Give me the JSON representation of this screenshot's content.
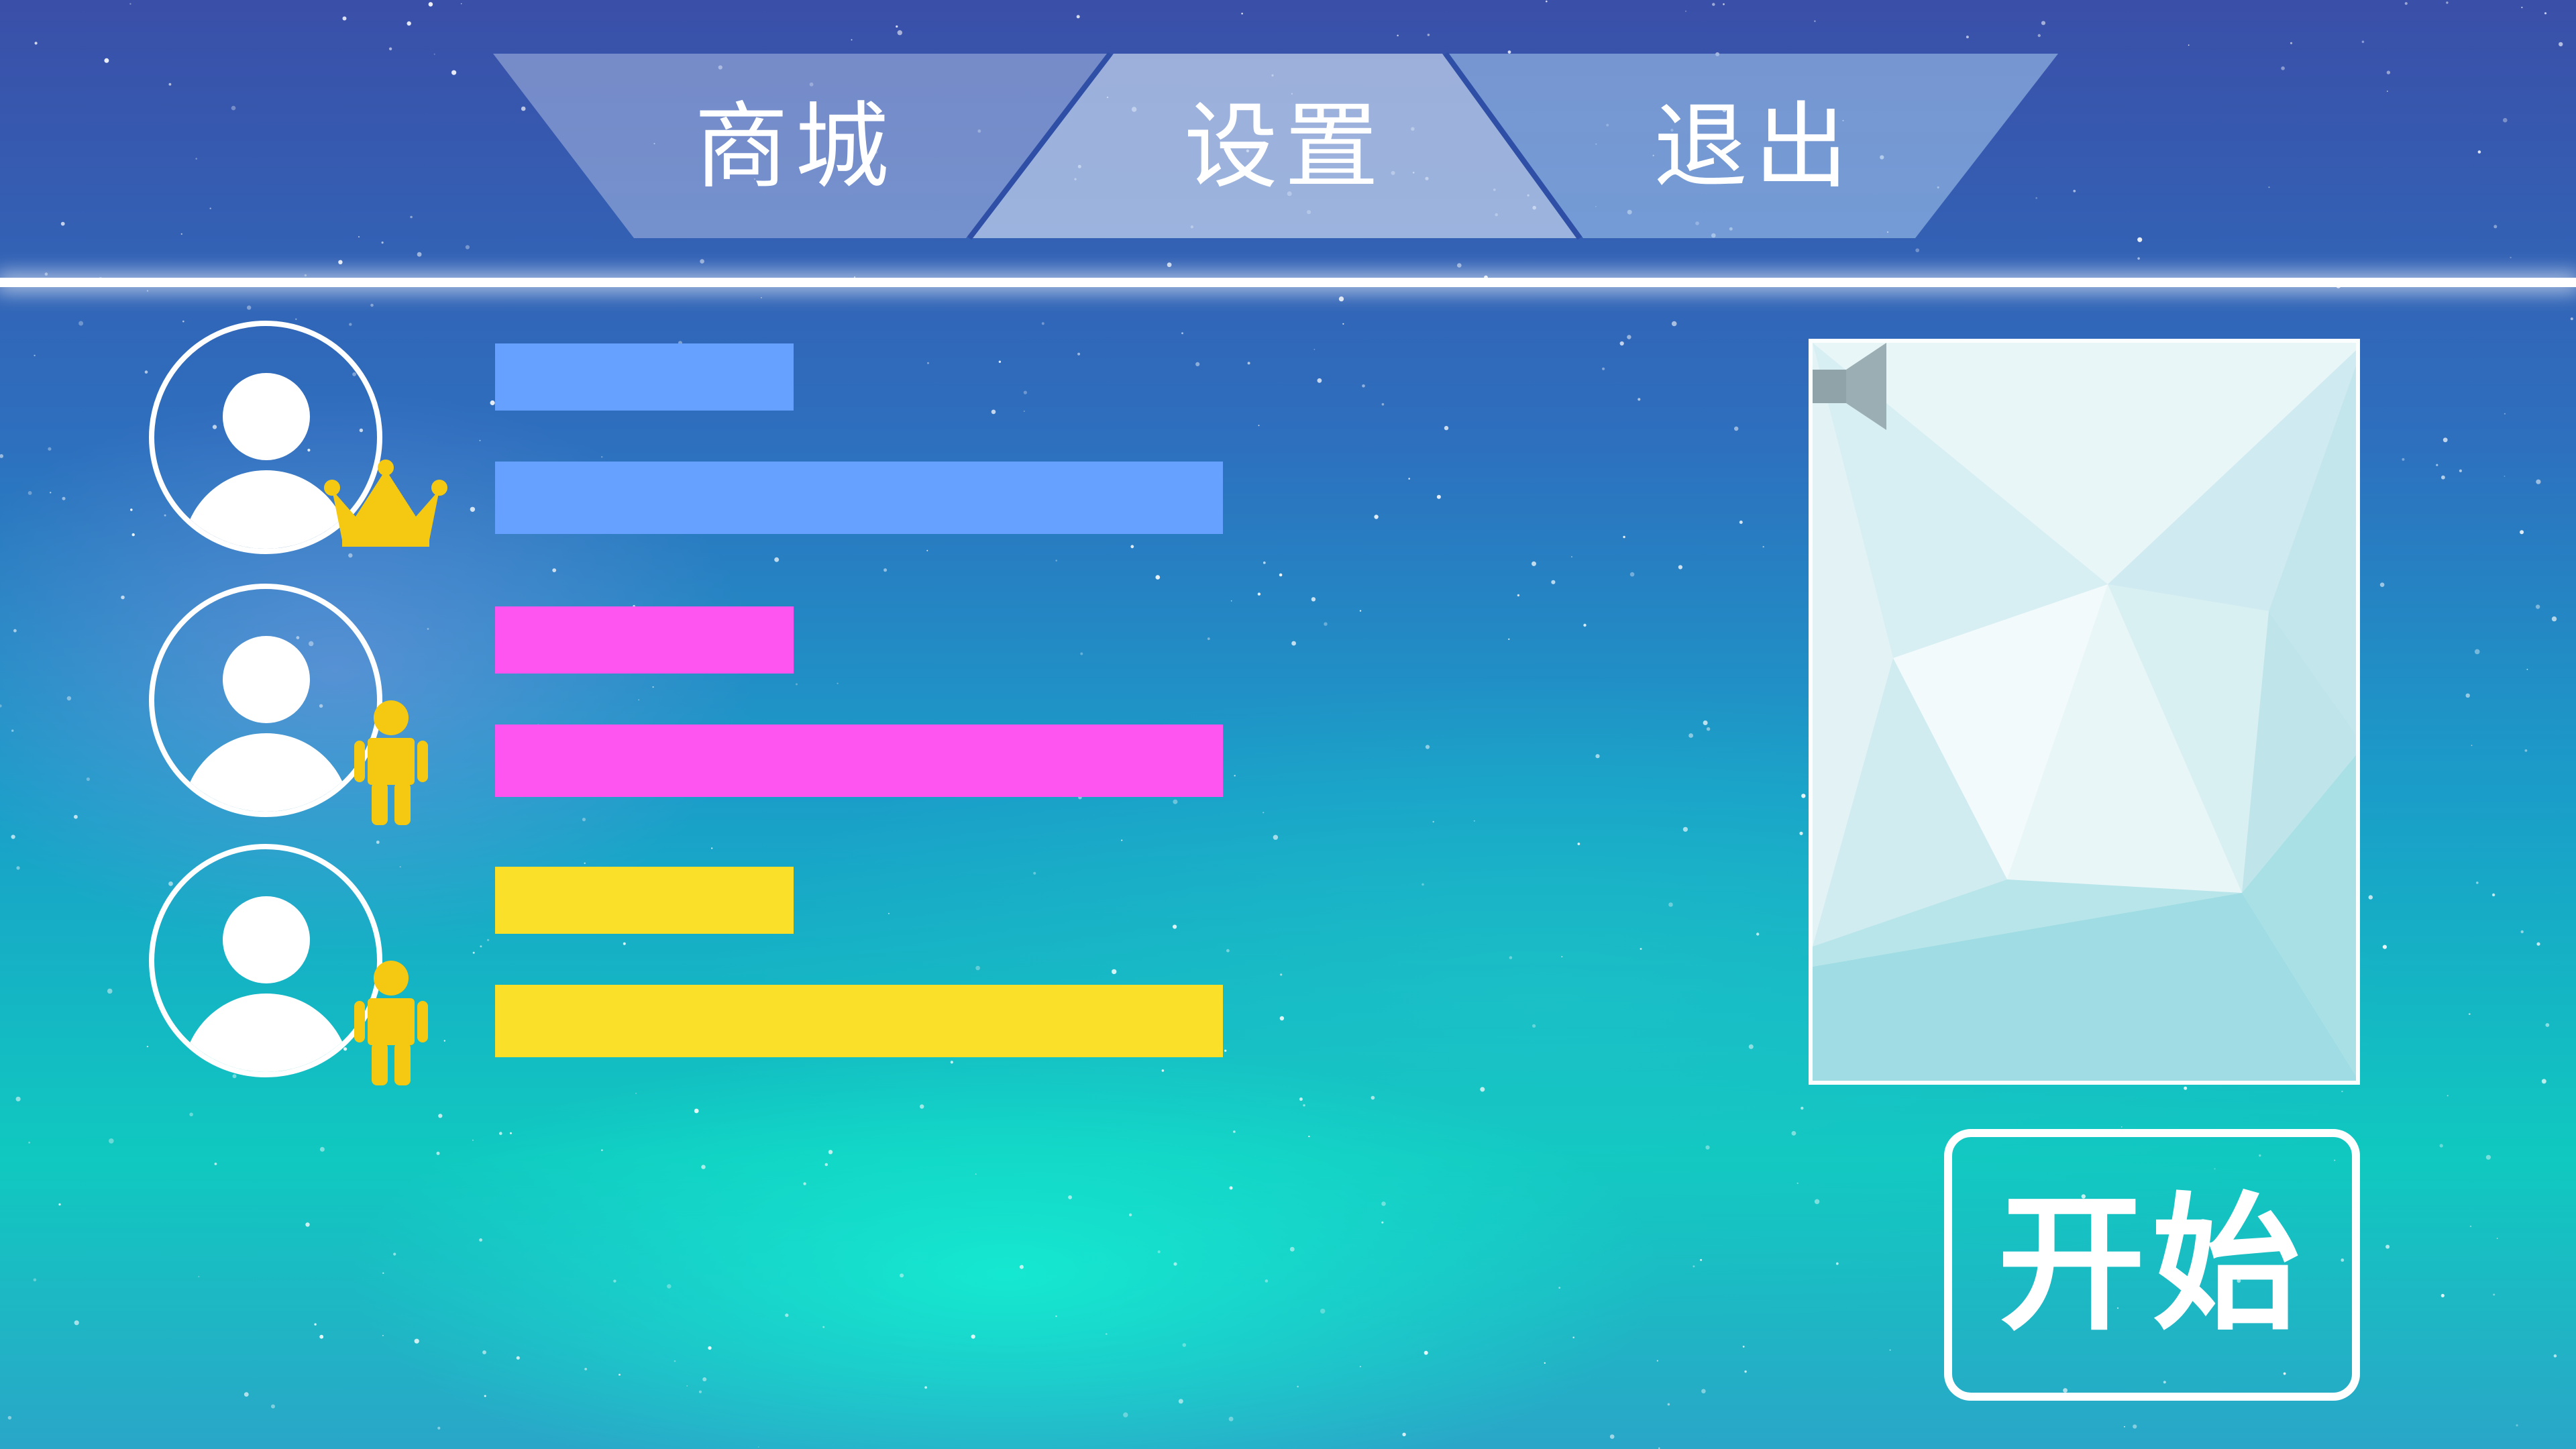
{
  "nav": {
    "items": [
      {
        "label": "商城"
      },
      {
        "label": "设置"
      },
      {
        "label": "退出"
      }
    ]
  },
  "players": [
    {
      "badge": "crown-icon",
      "color": "#66a1ff"
    },
    {
      "badge": "person-icon",
      "color": "#ff55f0"
    },
    {
      "badge": "person-icon",
      "color": "#fbe02a"
    }
  ],
  "badge_color": "#f5c812",
  "start": {
    "label": "开始"
  },
  "icons": {
    "speaker": "speaker-muted-icon"
  }
}
